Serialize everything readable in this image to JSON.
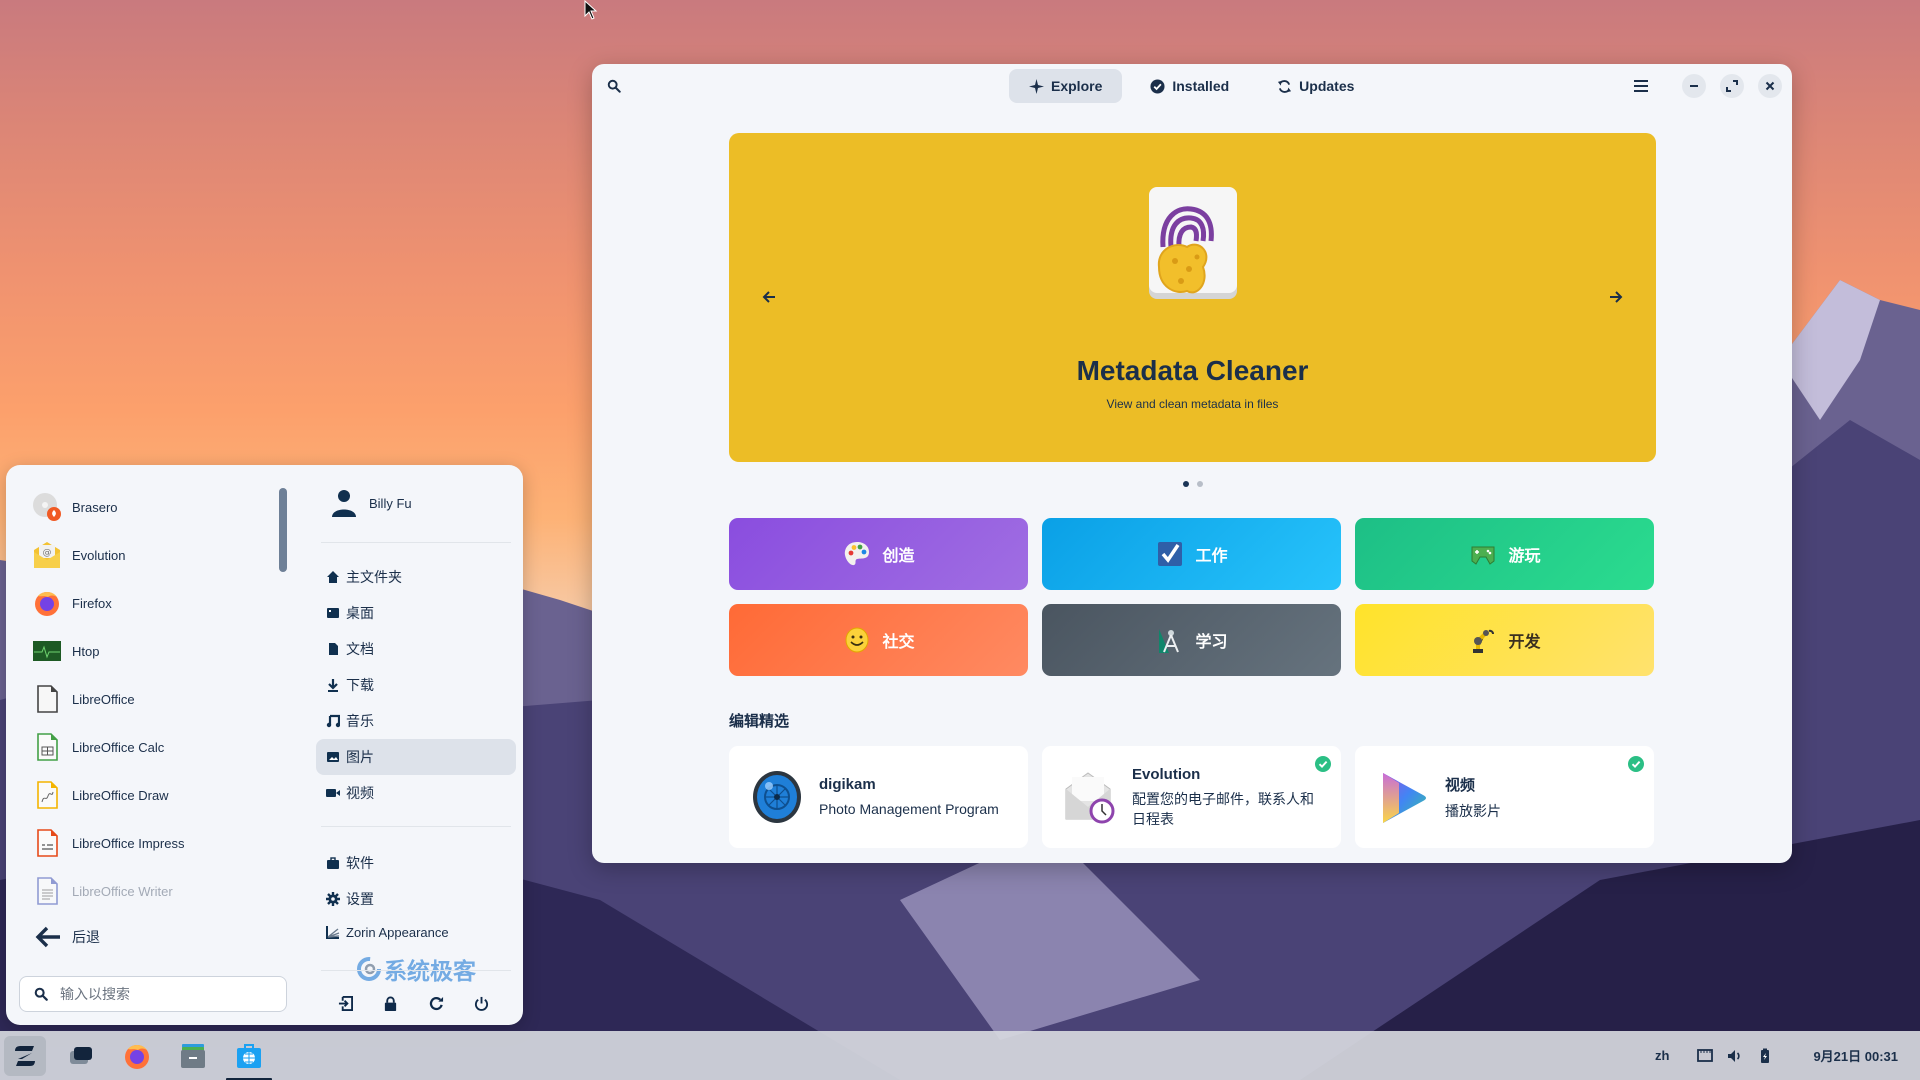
{
  "window": {
    "tabs": [
      {
        "label": "Explore",
        "icon": "sparkle-icon",
        "active": true
      },
      {
        "label": "Installed",
        "icon": "check-circle-icon",
        "active": false
      },
      {
        "label": "Updates",
        "icon": "refresh-icon",
        "active": false
      }
    ],
    "banner": {
      "title": "Metadata Cleaner",
      "subtitle": "View and clean metadata in files",
      "color": "#ecbd26",
      "page": 1,
      "pages": 2
    },
    "categories": [
      {
        "label": "创造",
        "icon": "palette-icon"
      },
      {
        "label": "工作",
        "icon": "checkbox-icon"
      },
      {
        "label": "游玩",
        "icon": "gamepad-icon"
      },
      {
        "label": "社交",
        "icon": "smiley-icon"
      },
      {
        "label": "学习",
        "icon": "compass-icon"
      },
      {
        "label": "开发",
        "icon": "robot-arm-icon"
      }
    ],
    "featured_title": "编辑精选",
    "featured": [
      {
        "name": "digikam",
        "desc": "Photo Management Program",
        "installed": false
      },
      {
        "name": "Evolution",
        "desc": "配置您的电子邮件，联系人和日程表",
        "installed": true
      },
      {
        "name": "视频",
        "desc": "播放影片",
        "installed": true
      }
    ]
  },
  "menu": {
    "apps": [
      {
        "label": "Brasero",
        "icon": "brasero-icon"
      },
      {
        "label": "Evolution",
        "icon": "evolution-icon"
      },
      {
        "label": "Firefox",
        "icon": "firefox-icon"
      },
      {
        "label": "Htop",
        "icon": "htop-icon"
      },
      {
        "label": "LibreOffice",
        "icon": "libreoffice-icon"
      },
      {
        "label": "LibreOffice Calc",
        "icon": "calc-icon"
      },
      {
        "label": "LibreOffice Draw",
        "icon": "draw-icon"
      },
      {
        "label": "LibreOffice Impress",
        "icon": "impress-icon"
      },
      {
        "label": "LibreOffice Writer",
        "icon": "writer-icon"
      }
    ],
    "back_label": "后退",
    "search_placeholder": "输入以搜索",
    "user_name": "Billy Fu",
    "places": [
      {
        "label": "主文件夹",
        "icon": "home-icon"
      },
      {
        "label": "桌面",
        "icon": "desktop-icon"
      },
      {
        "label": "文档",
        "icon": "document-icon"
      },
      {
        "label": "下载",
        "icon": "download-icon"
      },
      {
        "label": "音乐",
        "icon": "music-icon"
      },
      {
        "label": "图片",
        "icon": "image-icon",
        "active": true
      },
      {
        "label": "视频",
        "icon": "video-icon"
      }
    ],
    "system": [
      {
        "label": "软件",
        "icon": "briefcase-icon"
      },
      {
        "label": "设置",
        "icon": "gear-icon"
      },
      {
        "label": "Zorin Appearance",
        "icon": "appearance-icon"
      }
    ],
    "watermark": "系统极客"
  },
  "taskbar": {
    "language": "zh",
    "datetime": "9月21日  00:31"
  }
}
